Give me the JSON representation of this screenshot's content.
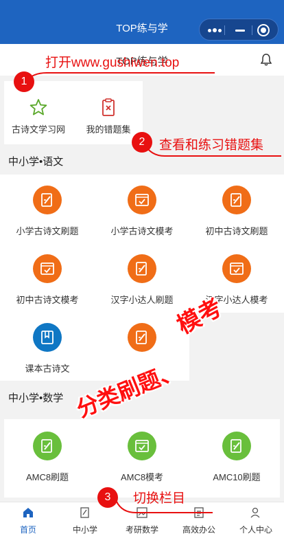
{
  "app": {
    "title": "TOP练与学",
    "subtitle": "TOP练与学"
  },
  "quick": [
    {
      "label": "古诗文学习网",
      "icon": "star-icon"
    },
    {
      "label": "我的错题集",
      "icon": "clipboard-x-icon"
    }
  ],
  "sections": {
    "chinese": {
      "title": "中小学•语文",
      "items": [
        {
          "label": "小学古诗文刷题",
          "icon": "edit-doc-icon",
          "color": "#f06d17"
        },
        {
          "label": "小学古诗文模考",
          "icon": "check-doc-icon",
          "color": "#f06d17"
        },
        {
          "label": "初中古诗文刷题",
          "icon": "edit-doc-icon",
          "color": "#f06d17"
        },
        {
          "label": "初中古诗文模考",
          "icon": "check-doc-icon",
          "color": "#f06d17"
        },
        {
          "label": "汉字小达人刷题",
          "icon": "edit-doc-icon",
          "color": "#f06d17"
        },
        {
          "label": "汉字小达人模考",
          "icon": "check-doc-icon",
          "color": "#f06d17"
        },
        {
          "label": "课本古诗文",
          "icon": "book-icon",
          "color": "#0f77c4"
        },
        {
          "label": "",
          "icon": "edit-doc-icon",
          "color": "#f06d17"
        }
      ]
    },
    "math": {
      "title": "中小学•数学",
      "items": [
        {
          "label": "AMC8刷题",
          "icon": "edit-doc-icon",
          "color": "#69bf3c"
        },
        {
          "label": "AMC8模考",
          "icon": "check-doc-icon",
          "color": "#69bf3c"
        },
        {
          "label": "AMC10刷题",
          "icon": "edit-doc-icon",
          "color": "#69bf3c"
        }
      ]
    }
  },
  "tabs": [
    {
      "label": "首页",
      "icon": "home-icon",
      "active": true
    },
    {
      "label": "中小学",
      "icon": "edit-doc-icon",
      "active": false
    },
    {
      "label": "考研数学",
      "icon": "image-doc-icon",
      "active": false
    },
    {
      "label": "高效办公",
      "icon": "doc-icon",
      "active": false
    },
    {
      "label": "个人中心",
      "icon": "user-icon",
      "active": false
    }
  ],
  "annotations": {
    "a1_num": "1",
    "a1_text": "打开www.gushiwen.top",
    "a2_num": "2",
    "a2_text": "查看和练习错题集",
    "a3_num": "3",
    "a3_text": "切换栏目",
    "big1": "模考",
    "big2": "分类刷题、"
  },
  "colors": {
    "primary": "#1e64c0",
    "annotation": "#e81010"
  }
}
